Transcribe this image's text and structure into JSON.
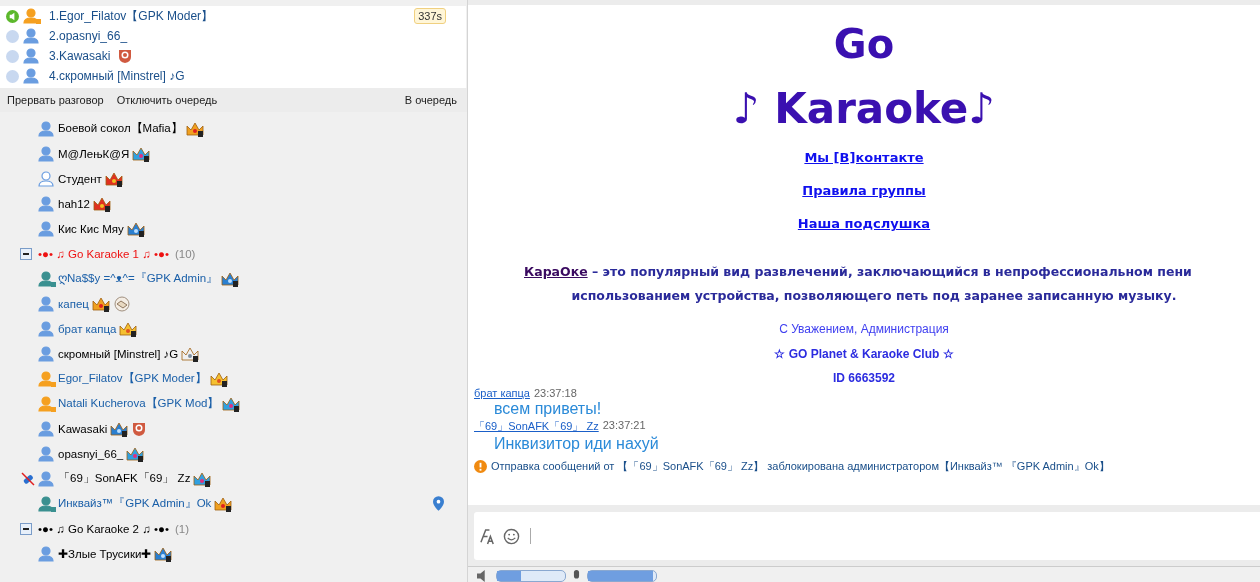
{
  "queue": {
    "timer": "337s",
    "items": [
      {
        "speaking": true,
        "kind": "moderator",
        "name": "1.Egor_Filatov【GPK Moder】"
      },
      {
        "speaking": false,
        "kind": "user",
        "name": "2.opasnyi_66_"
      },
      {
        "speaking": false,
        "kind": "user",
        "name": "3.Kawasaki",
        "badges": [
          {
            "kind": "shield"
          }
        ]
      },
      {
        "speaking": false,
        "kind": "user",
        "name": "4.скромный [Minstrel] ♪G"
      }
    ]
  },
  "queue_actions": {
    "left": [
      "Прервать разговор",
      "Отключить очередь"
    ],
    "right": "В очередь"
  },
  "tree": [
    {
      "kind": "user",
      "name": "Боевой сокол【Mafia】",
      "muted": false,
      "located": false,
      "badges": [
        {
          "kind": "crown-gold"
        }
      ]
    },
    {
      "kind": "user",
      "name": "M@ЛењК@Я",
      "muted": false,
      "located": false,
      "badges": [
        {
          "kind": "crown-rainbow"
        }
      ]
    },
    {
      "kind": "guest",
      "name": "Студент",
      "muted": false,
      "located": false,
      "badges": [
        {
          "kind": "crown-red"
        }
      ]
    },
    {
      "kind": "user",
      "name": "hah12",
      "muted": false,
      "located": false,
      "badges": [
        {
          "kind": "crown-red"
        }
      ]
    },
    {
      "kind": "user",
      "name": "Кис Кис Мяу",
      "muted": false,
      "located": false,
      "badges": [
        {
          "kind": "crown-blue"
        }
      ]
    },
    {
      "kind": "group",
      "name": "•●•  ♫ Go Karaoke 1 ♫   •●•",
      "count": "(10)",
      "color": "#ee1111",
      "expanded": true,
      "children": [
        {
          "kind": "admin",
          "name": "ღNa$$y =^ᴥ^=『GPK Admin』",
          "color": "#1a5fa8",
          "muted": false,
          "located": false,
          "badges": [
            {
              "kind": "crown-blue"
            }
          ]
        },
        {
          "kind": "user",
          "name": "капец",
          "color": "#1a5fa8",
          "muted": false,
          "located": false,
          "badges": [
            {
              "kind": "crown-gold"
            },
            {
              "kind": "handshake"
            }
          ]
        },
        {
          "kind": "user",
          "name": "брат капца",
          "color": "#1a5fa8",
          "muted": false,
          "located": false,
          "badges": [
            {
              "kind": "crown-yellow"
            }
          ]
        },
        {
          "kind": "user",
          "name": "скромный [Minstrel] ♪G",
          "muted": false,
          "located": false,
          "badges": [
            {
              "kind": "crown-white"
            }
          ]
        },
        {
          "kind": "moderator",
          "name": "Egor_Filatov【GPK Moder】",
          "color": "#1a5fa8",
          "muted": false,
          "located": false,
          "badges": [
            {
              "kind": "crown-yellow"
            }
          ]
        },
        {
          "kind": "moderator",
          "name": "Natali Kucherova【GPK Mod】",
          "color": "#1a5fa8",
          "muted": false,
          "located": false,
          "badges": [
            {
              "kind": "crown-rainbow"
            }
          ]
        },
        {
          "kind": "user",
          "name": "Kawasaki",
          "muted": false,
          "located": false,
          "badges": [
            {
              "kind": "crown-blue"
            },
            {
              "kind": "shield"
            }
          ]
        },
        {
          "kind": "user",
          "name": "opasnyi_66_",
          "muted": false,
          "located": false,
          "badges": [
            {
              "kind": "crown-rainbow"
            }
          ]
        },
        {
          "kind": "user",
          "name": "「69」SonAFK「69」 Zz",
          "muted": true,
          "located": false,
          "badges": [
            {
              "kind": "crown-rainbow"
            }
          ]
        },
        {
          "kind": "admin",
          "name": "Инквайз™『GPK Admin』Ok",
          "color": "#1a5fa8",
          "muted": false,
          "located": true,
          "badges": [
            {
              "kind": "crown-gold"
            }
          ]
        }
      ]
    },
    {
      "kind": "group",
      "name": "•●•  ♫ Go Karaoke 2 ♫   •●•",
      "count": "(1)",
      "expanded": true,
      "children": [
        {
          "kind": "user",
          "name": "✚Злые Трусики✚",
          "muted": false,
          "located": false,
          "badges": [
            {
              "kind": "crown-blue"
            }
          ]
        }
      ]
    }
  ],
  "welcome": {
    "title_1": "Go",
    "title_2": "♪ Karaoke♪",
    "links": [
      "Мы [В]контакте",
      "Правила группы",
      "Наша подслушка"
    ],
    "intro_link": "КараОке",
    "intro_line_1": " – это популярный вид развлечений, заключающийся в непрофессиональном пени",
    "intro_line_2": "использованием устройства, позволяющего петь под заранее записанную музыку.",
    "signature": "С Уважением, Администрация",
    "club": "☆ GO Planet & Karaoke Club ☆",
    "id": "ID 6663592"
  },
  "messages": [
    {
      "author": "брат капца",
      "time": "23:37:18",
      "text": "всем приветы!"
    },
    {
      "author": "「69」SonAFK「69」 Zz",
      "time": "23:37:21",
      "text": "Инквизитор иди нахуй"
    }
  ],
  "notice": "Отправка сообщений от 【「69」SonAFK「69」 Zz】 заблокирована администратором【Инквайз™ 『GPK Admin』Ok】",
  "audio": {
    "volume": {
      "level": 0.35
    },
    "mic": {
      "level": 0.95
    }
  }
}
